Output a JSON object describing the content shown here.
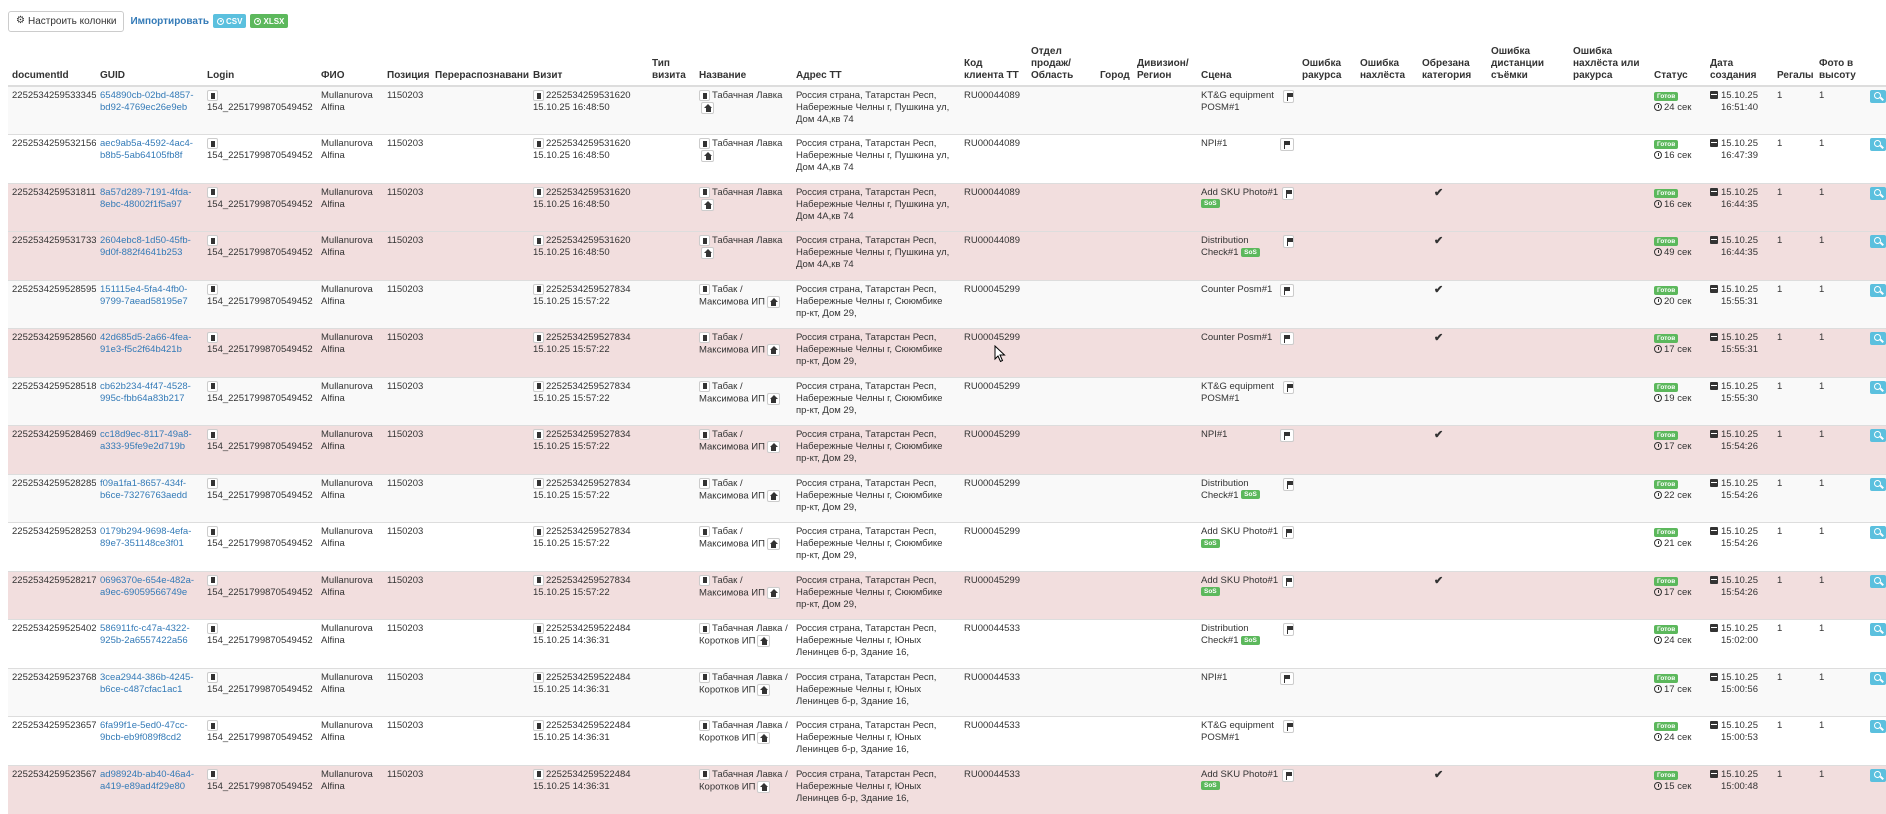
{
  "toolbar": {
    "config_label": "Настроить колонки",
    "import_label": "Импортировать",
    "csv_label": "CSV",
    "xlsx_label": "XLSX"
  },
  "columns": [
    {
      "key": "documentId",
      "label": "documentId"
    },
    {
      "key": "guid",
      "label": "GUID"
    },
    {
      "key": "login",
      "label": "Login"
    },
    {
      "key": "fio",
      "label": "ФИО"
    },
    {
      "key": "position",
      "label": "Позиция"
    },
    {
      "key": "rerec",
      "label": "Перераспознавание"
    },
    {
      "key": "visit",
      "label": "Визит"
    },
    {
      "key": "visit_type",
      "label": "Тип визита"
    },
    {
      "key": "name",
      "label": "Название"
    },
    {
      "key": "address",
      "label": "Адрес ТТ"
    },
    {
      "key": "client_code",
      "label": "Код клиента ТТ"
    },
    {
      "key": "sales_dept",
      "label": "Отдел продаж/ Область"
    },
    {
      "key": "city",
      "label": "Город"
    },
    {
      "key": "division",
      "label": "Дивизион/ Регион"
    },
    {
      "key": "scene",
      "label": "Сцена"
    },
    {
      "key": "angle_err",
      "label": "Ошибка ракурса"
    },
    {
      "key": "overlap_err",
      "label": "Ошибка нахлёста"
    },
    {
      "key": "cut_cat",
      "label": "Обрезана категория"
    },
    {
      "key": "dist_err",
      "label": "Ошибка дистанции съёмки"
    },
    {
      "key": "overlap_angle_err",
      "label": "Ошибка нахлёста или ракурса"
    },
    {
      "key": "status",
      "label": "Статус"
    },
    {
      "key": "created",
      "label": "Дата создания"
    },
    {
      "key": "shelves",
      "label": "Регалы"
    },
    {
      "key": "photo_h",
      "label": "Фото в высоту"
    }
  ],
  "so_badge": "SoS",
  "status_ready": "Готов",
  "rows": [
    {
      "doc": "2252534259533345",
      "guid": "654890cb-02bd-4857-bd92-4769ec26e9eb",
      "login": "154_2251799870549452",
      "fio": "Mullanurova Alfina",
      "pos": "1150203",
      "visit_id": "2252534259531620",
      "visit_time": "15.10.25 16:48:50",
      "name": "Табачная Лавка",
      "address": "Россия страна, Татарстан Респ, Набережные Челны г, Пушкина ул, Дом 4А,кв 74",
      "client": "RU00044089",
      "scene": "KT&G equipment POSM#1",
      "so": false,
      "cut": false,
      "dur": "24 сек",
      "date": "15.10.25",
      "time": "16:51:40",
      "shelves": "1",
      "photo": "1",
      "bad": false
    },
    {
      "doc": "2252534259532156",
      "guid": "aec9ab5a-4592-4ac4-b8b5-5ab64105fb8f",
      "login": "154_2251799870549452",
      "fio": "Mullanurova Alfina",
      "pos": "1150203",
      "visit_id": "2252534259531620",
      "visit_time": "15.10.25 16:48:50",
      "name": "Табачная Лавка",
      "address": "Россия страна, Татарстан Респ, Набережные Челны г, Пушкина ул, Дом 4А,кв 74",
      "client": "RU00044089",
      "scene": "NPI#1",
      "so": false,
      "cut": false,
      "dur": "16 сек",
      "date": "15.10.25",
      "time": "16:47:39",
      "shelves": "1",
      "photo": "1",
      "bad": false
    },
    {
      "doc": "2252534259531811",
      "guid": "8a57d289-7191-4fda-8ebc-48002f1f5a97",
      "login": "154_2251799870549452",
      "fio": "Mullanurova Alfina",
      "pos": "1150203",
      "visit_id": "2252534259531620",
      "visit_time": "15.10.25 16:48:50",
      "name": "Табачная Лавка",
      "address": "Россия страна, Татарстан Респ, Набережные Челны г, Пушкина ул, Дом 4А,кв 74",
      "client": "RU00044089",
      "scene": "Add SKU Photo#1",
      "so": true,
      "cut": true,
      "dur": "16 сек",
      "date": "15.10.25",
      "time": "16:44:35",
      "shelves": "1",
      "photo": "1",
      "bad": true
    },
    {
      "doc": "2252534259531733",
      "guid": "2604ebc8-1d50-45fb-9d0f-882f4641b253",
      "login": "154_2251799870549452",
      "fio": "Mullanurova Alfina",
      "pos": "1150203",
      "visit_id": "2252534259531620",
      "visit_time": "15.10.25 16:48:50",
      "name": "Табачная Лавка",
      "address": "Россия страна, Татарстан Респ, Набережные Челны г, Пушкина ул, Дом 4А,кв 74",
      "client": "RU00044089",
      "scene": "Distribution Check#1",
      "so": true,
      "cut": true,
      "dur": "49 сек",
      "date": "15.10.25",
      "time": "16:44:35",
      "shelves": "1",
      "photo": "1",
      "bad": true
    },
    {
      "doc": "2252534259528595",
      "guid": "151115e4-5fa4-4fb0-9799-7aead58195e7",
      "login": "154_2251799870549452",
      "fio": "Mullanurova Alfina",
      "pos": "1150203",
      "visit_id": "2252534259527834",
      "visit_time": "15.10.25 15:57:22",
      "name": "Табак / Максимова ИП",
      "address": "Россия страна, Татарстан Респ, Набережные Челны г, Сююмбике пр-кт, Дом 29,",
      "client": "RU00045299",
      "scene": "Counter Posm#1",
      "so": false,
      "cut": true,
      "dur": "20 сек",
      "date": "15.10.25",
      "time": "15:55:31",
      "shelves": "1",
      "photo": "1",
      "bad": false
    },
    {
      "doc": "2252534259528560",
      "guid": "42d685d5-2a66-4fea-91e3-f5c2f64b421b",
      "login": "154_2251799870549452",
      "fio": "Mullanurova Alfina",
      "pos": "1150203",
      "visit_id": "2252534259527834",
      "visit_time": "15.10.25 15:57:22",
      "name": "Табак / Максимова ИП",
      "address": "Россия страна, Татарстан Респ, Набережные Челны г, Сююмбике пр-кт, Дом 29,",
      "client": "RU00045299",
      "scene": "Counter Posm#1",
      "so": false,
      "cut": true,
      "dur": "17 сек",
      "date": "15.10.25",
      "time": "15:55:31",
      "shelves": "1",
      "photo": "1",
      "bad": true
    },
    {
      "doc": "2252534259528518",
      "guid": "cb62b234-4f47-4528-995c-fbb64a83b217",
      "login": "154_2251799870549452",
      "fio": "Mullanurova Alfina",
      "pos": "1150203",
      "visit_id": "2252534259527834",
      "visit_time": "15.10.25 15:57:22",
      "name": "Табак / Максимова ИП",
      "address": "Россия страна, Татарстан Респ, Набережные Челны г, Сююмбике пр-кт, Дом 29,",
      "client": "RU00045299",
      "scene": "KT&G equipment POSM#1",
      "so": false,
      "cut": false,
      "dur": "19 сек",
      "date": "15.10.25",
      "time": "15:55:30",
      "shelves": "1",
      "photo": "1",
      "bad": false
    },
    {
      "doc": "2252534259528469",
      "guid": "cc18d9ec-8117-49a8-a333-95fe9e2d719b",
      "login": "154_2251799870549452",
      "fio": "Mullanurova Alfina",
      "pos": "1150203",
      "visit_id": "2252534259527834",
      "visit_time": "15.10.25 15:57:22",
      "name": "Табак / Максимова ИП",
      "address": "Россия страна, Татарстан Респ, Набережные Челны г, Сююмбике пр-кт, Дом 29,",
      "client": "RU00045299",
      "scene": "NPI#1",
      "so": false,
      "cut": true,
      "dur": "17 сек",
      "date": "15.10.25",
      "time": "15:54:26",
      "shelves": "1",
      "photo": "1",
      "bad": true
    },
    {
      "doc": "2252534259528285",
      "guid": "f09a1fa1-8657-434f-b6ce-73276763aedd",
      "login": "154_2251799870549452",
      "fio": "Mullanurova Alfina",
      "pos": "1150203",
      "visit_id": "2252534259527834",
      "visit_time": "15.10.25 15:57:22",
      "name": "Табак / Максимова ИП",
      "address": "Россия страна, Татарстан Респ, Набережные Челны г, Сююмбике пр-кт, Дом 29,",
      "client": "RU00045299",
      "scene": "Distribution Check#1",
      "so": true,
      "cut": false,
      "dur": "22 сек",
      "date": "15.10.25",
      "time": "15:54:26",
      "shelves": "1",
      "photo": "1",
      "bad": false
    },
    {
      "doc": "2252534259528253",
      "guid": "0179b294-9698-4efa-89e7-351148ce3f01",
      "login": "154_2251799870549452",
      "fio": "Mullanurova Alfina",
      "pos": "1150203",
      "visit_id": "2252534259527834",
      "visit_time": "15.10.25 15:57:22",
      "name": "Табак / Максимова ИП",
      "address": "Россия страна, Татарстан Респ, Набережные Челны г, Сююмбике пр-кт, Дом 29,",
      "client": "RU00045299",
      "scene": "Add SKU Photo#1",
      "so": true,
      "cut": false,
      "dur": "21 сек",
      "date": "15.10.25",
      "time": "15:54:26",
      "shelves": "1",
      "photo": "1",
      "bad": false
    },
    {
      "doc": "2252534259528217",
      "guid": "0696370e-654e-482a-a9ec-69059566749e",
      "login": "154_2251799870549452",
      "fio": "Mullanurova Alfina",
      "pos": "1150203",
      "visit_id": "2252534259527834",
      "visit_time": "15.10.25 15:57:22",
      "name": "Табак / Максимова ИП",
      "address": "Россия страна, Татарстан Респ, Набережные Челны г, Сююмбике пр-кт, Дом 29,",
      "client": "RU00045299",
      "scene": "Add SKU Photo#1",
      "so": true,
      "cut": true,
      "dur": "17 сек",
      "date": "15.10.25",
      "time": "15:54:26",
      "shelves": "1",
      "photo": "1",
      "bad": true
    },
    {
      "doc": "2252534259525402",
      "guid": "586911fc-c47a-4322-925b-2a6557422a56",
      "login": "154_2251799870549452",
      "fio": "Mullanurova Alfina",
      "pos": "1150203",
      "visit_id": "2252534259522484",
      "visit_time": "15.10.25 14:36:31",
      "name": "Табачная Лавка / Коротков ИП",
      "address": "Россия страна, Татарстан Респ, Набережные Челны г, Юных Ленинцев б-р, Здание 16,",
      "client": "RU00044533",
      "scene": "Distribution Check#1",
      "so": true,
      "cut": false,
      "dur": "24 сек",
      "date": "15.10.25",
      "time": "15:02:00",
      "shelves": "1",
      "photo": "1",
      "bad": false
    },
    {
      "doc": "2252534259523768",
      "guid": "3cea2944-386b-4245-b6ce-c487cfac1ac1",
      "login": "154_2251799870549452",
      "fio": "Mullanurova Alfina",
      "pos": "1150203",
      "visit_id": "2252534259522484",
      "visit_time": "15.10.25 14:36:31",
      "name": "Табачная Лавка / Коротков ИП",
      "address": "Россия страна, Татарстан Респ, Набережные Челны г, Юных Ленинцев б-р, Здание 16,",
      "client": "RU00044533",
      "scene": "NPI#1",
      "so": false,
      "cut": false,
      "dur": "17 сек",
      "date": "15.10.25",
      "time": "15:00:56",
      "shelves": "1",
      "photo": "1",
      "bad": false
    },
    {
      "doc": "2252534259523657",
      "guid": "6fa99f1e-5ed0-47cc-9bcb-eb9f089f8cd2",
      "login": "154_2251799870549452",
      "fio": "Mullanurova Alfina",
      "pos": "1150203",
      "visit_id": "2252534259522484",
      "visit_time": "15.10.25 14:36:31",
      "name": "Табачная Лавка / Коротков ИП",
      "address": "Россия страна, Татарстан Респ, Набережные Челны г, Юных Ленинцев б-р, Здание 16,",
      "client": "RU00044533",
      "scene": "KT&G equipment POSM#1",
      "so": false,
      "cut": false,
      "dur": "24 сек",
      "date": "15.10.25",
      "time": "15:00:53",
      "shelves": "1",
      "photo": "1",
      "bad": false
    },
    {
      "doc": "2252534259523567",
      "guid": "ad98924b-ab40-46a4-a419-e89ad4f29e80",
      "login": "154_2251799870549452",
      "fio": "Mullanurova Alfina",
      "pos": "1150203",
      "visit_id": "2252534259522484",
      "visit_time": "15.10.25 14:36:31",
      "name": "Табачная Лавка / Коротков ИП",
      "address": "Россия страна, Татарстан Респ, Набережные Челны г, Юных Ленинцев б-р, Здание 16,",
      "client": "RU00044533",
      "scene": "Add SKU Photo#1",
      "so": true,
      "cut": true,
      "dur": "15 сек",
      "date": "15.10.25",
      "time": "15:00:48",
      "shelves": "1",
      "photo": "1",
      "bad": true
    }
  ]
}
